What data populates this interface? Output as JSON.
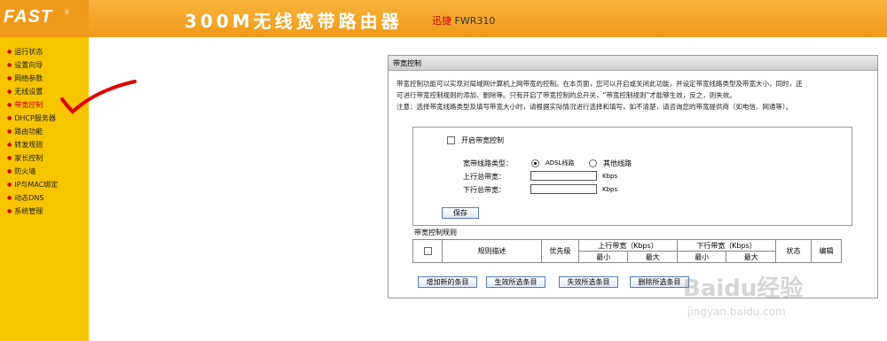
{
  "header": {
    "logo": "FAST",
    "trademark": "®",
    "title": "300M无线宽带路由器",
    "model_prefix": "迅捷",
    "model": "FWR310"
  },
  "sidebar": {
    "items": [
      {
        "label": "运行状态"
      },
      {
        "label": "设置向导"
      },
      {
        "label": "网络参数"
      },
      {
        "label": "无线设置"
      },
      {
        "label": "带宽控制",
        "active": true
      },
      {
        "label": "DHCP服务器"
      },
      {
        "label": "路由功能"
      },
      {
        "label": "转发规则"
      },
      {
        "label": "家长控制"
      },
      {
        "label": "防火墙"
      },
      {
        "label": "IP与MAC绑定"
      },
      {
        "label": "动态DNS"
      },
      {
        "label": "系统管理"
      }
    ]
  },
  "panel": {
    "title": "带宽控制",
    "desc1": "带宽控制功能可以实现对局域网计算机上网带宽的控制。在本页面，您可以开启或关闭此功能，并设定带宽线路类型及带宽大小，同时，还",
    "desc2": "可进行带宽控制规则的添加、删除等。只有开启了带宽控制的总开关，“带宽控制规则”才能够生效，反之，则失效。",
    "note": "注意：选择带宽线路类型及填写带宽大小时，请根据实际情况进行选择和填写，如不清楚，请咨询您的带宽提供商（如电信、网通等）。",
    "enable_label": "开启带宽控制",
    "line_type_label": "宽带线路类型：",
    "adsl_label": "ADSL线路",
    "other_label": "其他线路",
    "up_label": "上行总带宽：",
    "down_label": "下行总带宽：",
    "up_value": "",
    "down_value": "",
    "unit": "Kbps",
    "save_label": "保存",
    "rules_label": "带宽控制规则",
    "table": {
      "col_desc": "规则描述",
      "col_priority": "优先级",
      "col_up": "上行带宽（Kbps）",
      "col_down": "下行带宽（Kbps）",
      "col_status": "状态",
      "col_edit": "编辑",
      "min": "最小",
      "max": "最大"
    },
    "buttons": {
      "add": "增加新的条目",
      "enable": "生效所选条目",
      "disable": "失效所选条目",
      "delete": "删除所选条目"
    }
  },
  "watermark": {
    "brand": "Baidu经验",
    "url": "jingyan.baidu.com"
  }
}
